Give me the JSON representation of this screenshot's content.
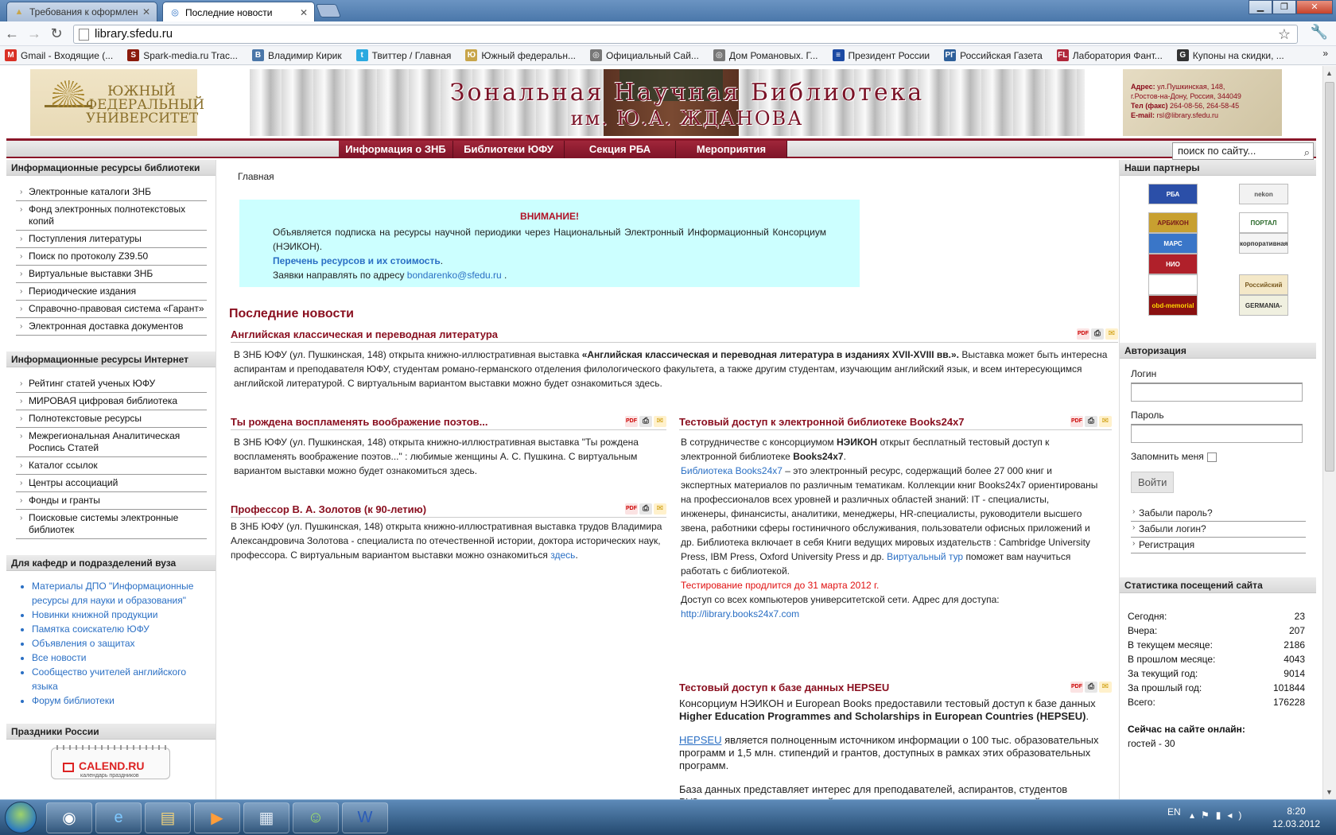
{
  "browser": {
    "tabs": [
      {
        "label": "Требования к оформлени",
        "active": false
      },
      {
        "label": "Последние новости",
        "active": true
      }
    ],
    "url": "library.sfedu.ru",
    "bookmarks": [
      {
        "label": "Gmail - Входящие (...",
        "color": "#d93025",
        "glyph": "M"
      },
      {
        "label": "Spark-media.ru Trac...",
        "color": "#8b1b0c",
        "glyph": "S"
      },
      {
        "label": "Владимир Кирик",
        "color": "#4a76a8",
        "glyph": "B"
      },
      {
        "label": "Твиттер / Главная",
        "color": "#2aa9e0",
        "glyph": "t"
      },
      {
        "label": "Южный федеральн...",
        "color": "#c8a54a",
        "glyph": "Ю"
      },
      {
        "label": "Официальный Сай...",
        "color": "#777777",
        "glyph": "◎"
      },
      {
        "label": "Дом Романовых. Г...",
        "color": "#777777",
        "glyph": "◎"
      },
      {
        "label": "Президент России",
        "color": "#1c4aa3",
        "glyph": "≡"
      },
      {
        "label": "Российская Газета",
        "color": "#2d5f9a",
        "glyph": "РГ"
      },
      {
        "label": "Лаборатория Фант...",
        "color": "#b0263a",
        "glyph": "FL"
      },
      {
        "label": "Купоны на скидки, ...",
        "color": "#333333",
        "glyph": "G"
      }
    ],
    "bookmarks_more": "»"
  },
  "header": {
    "logo_text": "Южный федеральный университет",
    "banner_title": "Зональная Научная Библиотека",
    "banner_subtitle": "им. Ю.А. ЖДАНОВА",
    "address_lines": [
      {
        "label": "Адрес:",
        "text": " ул.Пушкинская, 148,"
      },
      {
        "label": "",
        "text": " г.Ростов-на-Дону, Россия, 344049"
      },
      {
        "label": "Тел (факс)",
        "text": " 264-08-56, 264-58-45"
      },
      {
        "label": "E-mail:",
        "text": " rsl@library.sfedu.ru"
      }
    ]
  },
  "menu": [
    {
      "label": "Информация о ЗНБ",
      "w": 150
    },
    {
      "label": "Библиотеки ЮФУ",
      "w": 150
    },
    {
      "label": "Секция РБА",
      "w": 150
    },
    {
      "label": "Мероприятия",
      "w": 150
    }
  ],
  "search": {
    "placeholder": "поиск по сайту..."
  },
  "left": {
    "box1_title": "Информационные ресурсы библиотеки",
    "box1_items": [
      "Электронные каталоги ЗНБ",
      "Фонд электронных полнотекстовых копий",
      "Поступления литературы",
      "Поиск по протоколу Z39.50",
      "Виртуальные выставки ЗНБ",
      "Периодические издания",
      "Справочно-правовая система «Гарант»",
      "Электронная доставка документов"
    ],
    "box2_title": "Информационные ресурсы Интернет",
    "box2_items": [
      "Рейтинг статей ученых ЮФУ",
      "МИРОВАЯ цифровая библиотека",
      "Полнотекстовые ресурсы",
      "Межрегиональная Аналитическая Роспись Статей",
      "Каталог ссылок",
      "Центры ассоциаций",
      "Фонды и гранты",
      "Поисковые системы электронные библиотек"
    ],
    "box3_title": "Для кафедр и подразделений вуза",
    "box3_items": [
      "Материалы ДПО \"Информационные ресурсы для науки и образования\"",
      "Новинки книжной продукции",
      "Памятка соискателю ЮФУ",
      "Объявления о защитах",
      "Все новости",
      "Сообщество учителей английского языка",
      "Форум библиотеки"
    ],
    "box4_title": "Праздники России",
    "calend_logo": "CALEND.RU",
    "calend_sub": "календарь праздников"
  },
  "main": {
    "breadcrumb": "Главная",
    "notice": {
      "title": "ВНИМАНИЕ!",
      "text": "Объявляется подписка на ресурсы научной периодики через Национальный Электронный Информационный Консорциум (НЭИКОН).",
      "link": "Перечень ресурсов и их стоимость",
      "link_after": ".",
      "contact_prefix": "Заявки направлять по адресу ",
      "contact_email": "bondarenko@sfedu.ru",
      "contact_after": " ."
    },
    "section_title": "Последние новости",
    "articles": {
      "a1": {
        "title": "Английская классическая и переводная литература",
        "pre": "В ЗНБ ЮФУ (ул. Пушкинская, 148) открыта книжно-иллюстративная выставка ",
        "bold": "«Английская классическая и переводная литература в изданиях XVII-XVIII вв.».",
        "post": " Выставка может быть интересна аспирантам и преподавателя ЮФУ, студентам романо-германского отделения филологического факультета, а также другим студентам, изучающим английский язык, и всем интересующимся английской литературой. С виртуальным вариантом выставки можно будет ознакомиться здесь."
      },
      "a2": {
        "title": "Ты рождена воспламенять воображение поэтов...",
        "body": "В ЗНБ ЮФУ (ул. Пушкинская, 148) открыта книжно-иллюстративная выставка \"Ты рождена воспламенять воображение поэтов...\" : любимые женщины А. С. Пушкина. С виртуальным вариантом выставки можно будет ознакомиться здесь."
      },
      "a3": {
        "title": "Профессор В. А. Золотов (к 90-летию)",
        "body": "В ЗНБ ЮФУ (ул. Пушкинская, 148) открыта книжно-иллюстративная выставка трудов Владимира Александровича Золотова - специалиста по отечественной истории, доктора исторических наук, профессора. С виртуальным вариантом выставки можно ознакомиться ",
        "link": "здесь",
        "after": "."
      },
      "a4": {
        "title": "Тестовый доступ к электронной библиотеке Books24x7",
        "p1_pre": "В сотрудничестве с консорциумом ",
        "p1_bold": "НЭИКОН",
        "p1_mid": " открыт бесплатный тестовый доступ к электронной библиотеке ",
        "p1_bold2": "Books24x7",
        "p1_end": ".",
        "link1": "Библиотека Books24x7",
        "p2": " – это электронный ресурс, содержащий более 27 000 книг и экспертных материалов по различным тематикам. Коллекции книг Books24x7 ориентированы на профессионалов всех уровней и различных областей знаний: IT - специалисты, инженеры, финансисты, аналитики, менеджеры, HR-специалисты, руководители высшего звена, работники сферы гостиничного обслуживания, пользователи офисных приложений и др. Библиотека включает в себя Книги ведущих мировых издательств : Cambridge University Press, IBM Press, Oxford University Press и др. ",
        "link2": "Виртуальный тур",
        "p2_end": " поможет вам научиться работать с библиотекой.",
        "red": "Тестирование продлится до 31 марта 2012 г.",
        "p3": "Доступ со всех компьютеров университетской сети. Адрес для доступа:",
        "url": "http://library.books24x7.com"
      },
      "a5": {
        "title": "Тестовый доступ к базе данных HEPSEU",
        "p1_pre": "Консорциум НЭИКОН и European Books предоставили тестовый доступ к базе данных ",
        "p1_bold": "Higher Education Programmes and Scholarships in European Countries (HEPSEU)",
        "p1_end": ".",
        "link": "HEPSEU",
        "p2": " является полноценным источником информации о 100 тыс. образовательных программ и 1,5 млн. стипендий и грантов, доступных в рамках этих образовательных программ.",
        "p3": "База данных представляет интерес для преподавателей, аспирантов, студентов ВУЗов, ученых, исследователей, которые хотят принять участие в европейских образовательных"
      }
    },
    "icon_labels": {
      "pdf": "PDF",
      "print": "⎙",
      "email": "✉"
    }
  },
  "right": {
    "partners_title": "Наши партнеры",
    "partners": [
      {
        "label": "РБА",
        "bg": "#2b4fa8",
        "fg": "#ffffff"
      },
      {
        "label": "nekon",
        "bg": "#f2f2f2",
        "fg": "#555555"
      },
      {
        "label": "АРБИКОН",
        "bg": "#c8a030",
        "fg": "#7a1a1a"
      },
      {
        "label": "ПОРТАЛ LIBRARY.RU",
        "bg": "#ffffff",
        "fg": "#2a6a2a"
      },
      {
        "label": "МАРС",
        "bg": "#3a76c8",
        "fg": "#ffffff"
      },
      {
        "label": "корпоративная сеть",
        "bg": "#f4f4f4",
        "fg": "#333333"
      },
      {
        "label": "НИО",
        "bg": "#b0202a",
        "fg": "#ffffff"
      },
      {
        "label": "",
        "bg": "#ffffff",
        "fg": "#333333"
      },
      {
        "label": "Российский комитет",
        "bg": "#f4e8c8",
        "fg": "#7a5a20"
      },
      {
        "label": "obd-memorial",
        "bg": "#8a1010",
        "fg": "#ffd700"
      },
      {
        "label": "GERMANIA-ONLINE.RU",
        "bg": "#f0f0e0",
        "fg": "#333333"
      }
    ],
    "auth_title": "Авторизация",
    "login_label": "Логин",
    "password_label": "Пароль",
    "remember_label": "Запомнить меня",
    "login_button": "Войти",
    "auth_links": [
      "Забыли пароль?",
      "Забыли логин?",
      "Регистрация"
    ],
    "stats_title": "Статистика посещений сайта",
    "stats": [
      {
        "label": "Сегодня:",
        "value": "23"
      },
      {
        "label": "Вчера:",
        "value": "207"
      },
      {
        "label": "В текущем месяце:",
        "value": "2186"
      },
      {
        "label": "В прошлом месяце:",
        "value": "4043"
      },
      {
        "label": "За текущий год:",
        "value": "9014"
      },
      {
        "label": "За прошлый год:",
        "value": "101844"
      },
      {
        "label": "Всего:",
        "value": "176228"
      }
    ],
    "online_title": "Сейчас на сайте онлайн:",
    "online_text": "гостей - 30"
  },
  "taskbar": {
    "apps": [
      {
        "name": "chrome",
        "glyph": "◉"
      },
      {
        "name": "ie",
        "glyph": "e"
      },
      {
        "name": "explorer",
        "glyph": "▤"
      },
      {
        "name": "media",
        "glyph": "▶"
      },
      {
        "name": "calculator",
        "glyph": "▦"
      },
      {
        "name": "messenger",
        "glyph": "☺"
      },
      {
        "name": "word",
        "glyph": "W"
      }
    ],
    "lang": "EN",
    "time": "8:20",
    "date": "12.03.2012"
  }
}
